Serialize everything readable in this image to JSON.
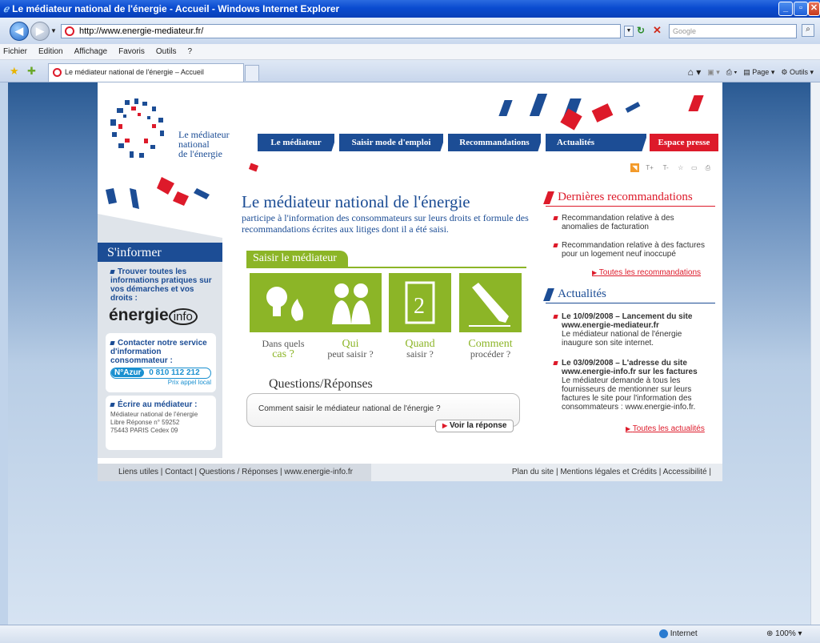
{
  "window": {
    "title": "Le médiateur national de l'énergie - Accueil - Windows Internet Explorer"
  },
  "browser": {
    "url": "http://www.energie-mediateur.fr/",
    "search_placeholder": "Google",
    "menu": [
      "Fichier",
      "Edition",
      "Affichage",
      "Favoris",
      "Outils",
      "?"
    ],
    "tab_title": "Le médiateur national de l'énergie – Accueil",
    "tools": {
      "page": "Page",
      "outils": "Outils"
    },
    "status": {
      "zone": "Internet",
      "zoom": "100%"
    }
  },
  "site": {
    "logo": {
      "line1": "Le médiateur",
      "line2": "national",
      "line3": "de l'énergie"
    },
    "nav": [
      "Le médiateur",
      "Saisir mode d'emploi",
      "Recommandations",
      "Actualités",
      "Espace presse"
    ],
    "utility_icons": [
      "rss-icon",
      "text-larger-icon",
      "text-smaller-icon",
      "star-icon",
      "comment-icon",
      "print-icon"
    ],
    "utility_labels": {
      "text_plus": "T+",
      "text_minus": "T-"
    },
    "headline": "Le médiateur national de l'énergie",
    "intro": "participe à l'information des consommateurs sur leurs droits et formule des recommandations écrites aux litiges dont il a été saisi.",
    "saisir": {
      "title": "Saisir le médiateur",
      "cards": [
        {
          "top": "Dans quels",
          "key": "cas ?",
          "bottom": ""
        },
        {
          "top": "",
          "key": "Qui",
          "bottom": "peut saisir ?"
        },
        {
          "top": "",
          "key": "Quand",
          "bottom": "saisir ?"
        },
        {
          "top": "",
          "key": "Comment",
          "bottom": "procéder ?"
        }
      ]
    },
    "qr": {
      "title": "Questions/Réponses",
      "question": "Comment saisir le médiateur national de l'énergie ?",
      "button": "Voir la réponse"
    },
    "sidebar": {
      "title": "S'informer",
      "item1": "Trouver toutes les informations pratiques sur vos démarches et vos droits :",
      "energie_logo": "énergie",
      "energie_logo_suffix": "info",
      "contact_title": "Contacter notre service d'information consommateur :",
      "azur_badge": "N°Azur",
      "phone": "0 810 112 212",
      "price": "Prix appel local",
      "write_title": "Écrire au médiateur :",
      "address": [
        "Médiateur national de l'énergie",
        "Libre Réponse n° 59252",
        "75443 PARIS Cedex 09"
      ]
    },
    "recos": {
      "title": "Dernières recommandations",
      "items": [
        "Recommandation relative à des anomalies de facturation",
        "Recommandation relative à des factures pour un logement neuf inoccupé"
      ],
      "all": "Toutes les recommandations"
    },
    "news": {
      "title": "Actualités",
      "items": [
        {
          "head": "Le 10/09/2008 – Lancement du site www.energie-mediateur.fr",
          "body": "Le médiateur national de l'énergie inaugure son site internet."
        },
        {
          "head": "Le 03/09/2008 – L'adresse du site www.energie-info.fr sur les factures",
          "body": "Le médiateur demande à tous les fournisseurs de mentionner sur leurs factures le site pour l'information des consommateurs : www.energie-info.fr."
        }
      ],
      "all": "Toutes les actualités"
    },
    "footer": {
      "left": [
        "Liens utiles",
        "Contact",
        "Questions / Réponses",
        "www.energie-info.fr"
      ],
      "right": [
        "Plan du site",
        "Mentions légales et Crédits",
        "Accessibilité"
      ]
    }
  },
  "colors": {
    "blue": "#1c4d95",
    "red": "#dd1a2a",
    "green": "#8cb527"
  }
}
